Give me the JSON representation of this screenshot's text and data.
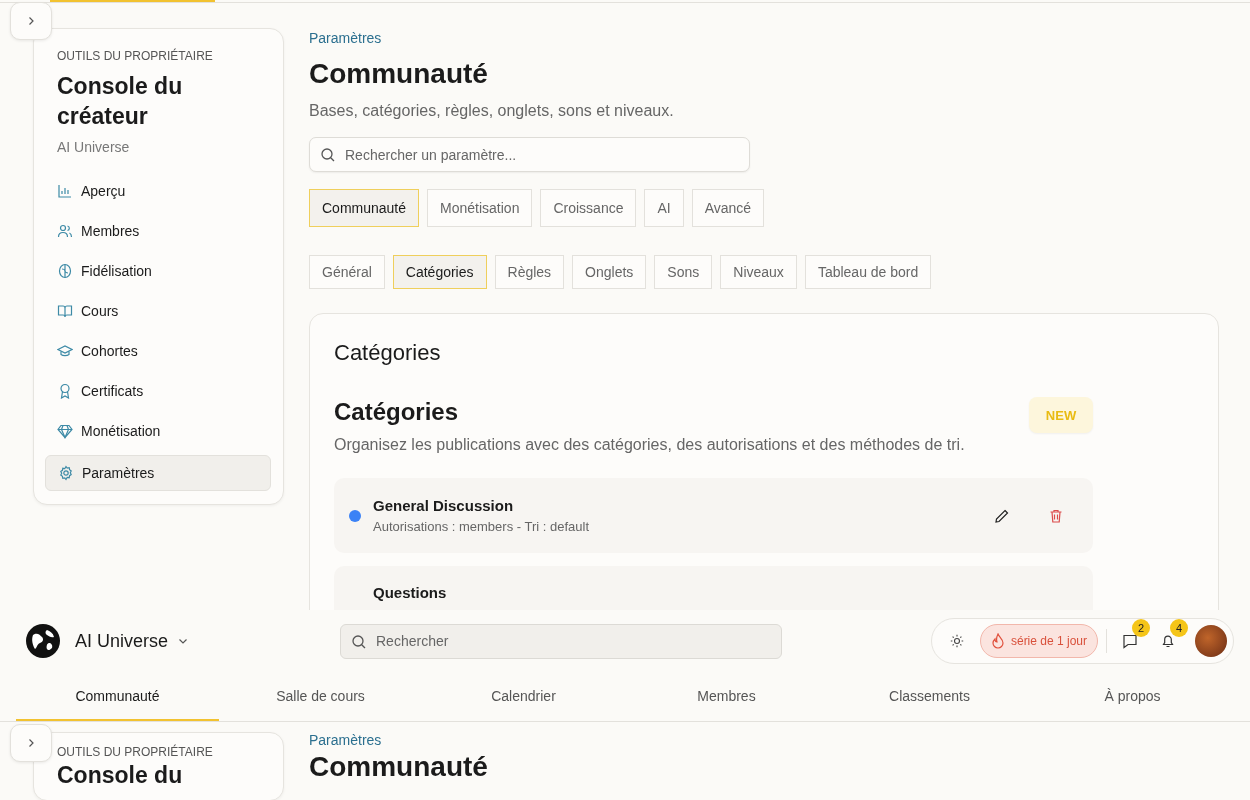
{
  "upper_page": {
    "sidebar": {
      "eyebrow": "OUTILS DU PROPRIÉTAIRE",
      "title": "Console du créateur",
      "subtitle": "AI Universe",
      "items": [
        {
          "label": "Aperçu",
          "selected": false
        },
        {
          "label": "Membres",
          "selected": false
        },
        {
          "label": "Fidélisation",
          "selected": false
        },
        {
          "label": "Cours",
          "selected": false
        },
        {
          "label": "Cohortes",
          "selected": false
        },
        {
          "label": "Certificats",
          "selected": false
        },
        {
          "label": "Monétisation",
          "selected": false
        },
        {
          "label": "Paramètres",
          "selected": true
        }
      ]
    },
    "main": {
      "breadcrumb": "Paramètres",
      "title": "Communauté",
      "description": "Bases, catégories, règles, onglets, sons et niveaux.",
      "search": {
        "placeholder": "Rechercher un paramètre..."
      },
      "tabs": [
        {
          "label": "Communauté",
          "selected": true
        },
        {
          "label": "Monétisation",
          "selected": false
        },
        {
          "label": "Croissance",
          "selected": false
        },
        {
          "label": "AI",
          "selected": false
        },
        {
          "label": "Avancé",
          "selected": false
        }
      ],
      "subtabs": [
        {
          "label": "Général",
          "selected": false
        },
        {
          "label": "Catégories",
          "selected": true
        },
        {
          "label": "Règles",
          "selected": false
        },
        {
          "label": "Onglets",
          "selected": false
        },
        {
          "label": "Sons",
          "selected": false
        },
        {
          "label": "Niveaux",
          "selected": false
        },
        {
          "label": "Tableau de bord",
          "selected": false
        }
      ],
      "panel": {
        "title": "Catégories",
        "section_title": "Catégories",
        "badge": "NEW",
        "description": "Organisez les publications avec des catégories, des autorisations et des méthodes de tri.",
        "categories": [
          {
            "name": "General Discussion",
            "details": "Autorisations : members - Tri : default",
            "color": "#3b82f6"
          },
          {
            "name": "Questions"
          }
        ]
      }
    }
  },
  "header": {
    "community": "AI Universe",
    "search": {
      "placeholder": "Rechercher"
    },
    "streak": "série de 1 jour",
    "messages_badge": "2",
    "notifications_badge": "4",
    "nav": [
      {
        "label": "Communauté",
        "selected": true
      },
      {
        "label": "Salle de cours",
        "selected": false
      },
      {
        "label": "Calendrier",
        "selected": false
      },
      {
        "label": "Membres",
        "selected": false
      },
      {
        "label": "Classements",
        "selected": false
      },
      {
        "label": "À propos",
        "selected": false
      }
    ]
  },
  "lower_page": {
    "sidebar": {
      "eyebrow": "OUTILS DU PROPRIÉTAIRE",
      "title": "Console du"
    },
    "main": {
      "breadcrumb": "Paramètres",
      "title": "Communauté"
    }
  }
}
